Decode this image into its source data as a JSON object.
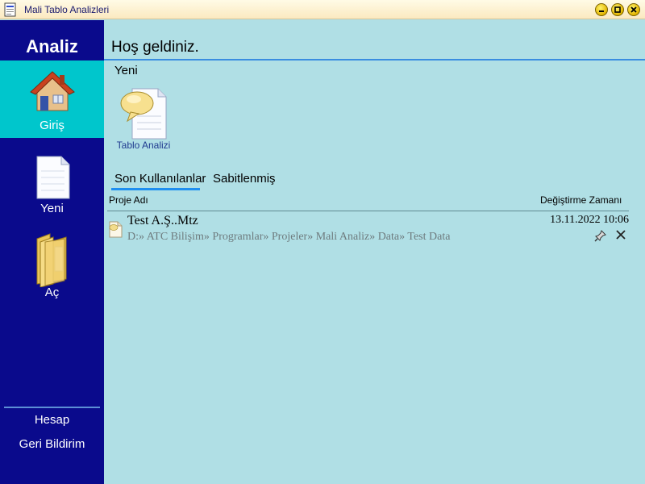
{
  "window": {
    "title": "Mali Tablo Analizleri",
    "controls": [
      "minimize-icon",
      "maximize-icon",
      "close-icon"
    ]
  },
  "sidebar": {
    "title": "Analiz",
    "items": [
      {
        "label": "Giriş",
        "icon": "house-icon",
        "active": true
      },
      {
        "label": "Yeni",
        "icon": "blank-document-icon",
        "active": false
      },
      {
        "label": "Aç",
        "icon": "folder-icon",
        "active": false
      }
    ],
    "bottom_links": [
      {
        "label": "Hesap"
      },
      {
        "label": "Geri Bildirim"
      }
    ]
  },
  "main": {
    "title": "Hoş geldiniz.",
    "new_section": {
      "label": "Yeni",
      "templates": [
        {
          "label": "Tablo Analizi",
          "icon": "document-speech-bubble-icon"
        }
      ]
    },
    "tabs": [
      {
        "label": "Son Kullanılanlar",
        "active": true
      },
      {
        "label": "Sabitlenmiş",
        "active": false
      }
    ],
    "columns": {
      "name": "Proje Adı",
      "modified": "Değiştirme Zamanı"
    },
    "recent": [
      {
        "name": "Test A.Ş..Mtz",
        "path": "D:» ATC Bilişim» Programlar» Projeler» Mali Analiz» Data» Test Data",
        "modified": "13.11.2022 10:06",
        "icon": "project-file-icon"
      }
    ]
  },
  "colors": {
    "sidebar_bg": "#0a0a8c",
    "sidebar_active": "#00c6cc",
    "content_bg": "#b0dfe5",
    "accent": "#1f8ff0"
  }
}
